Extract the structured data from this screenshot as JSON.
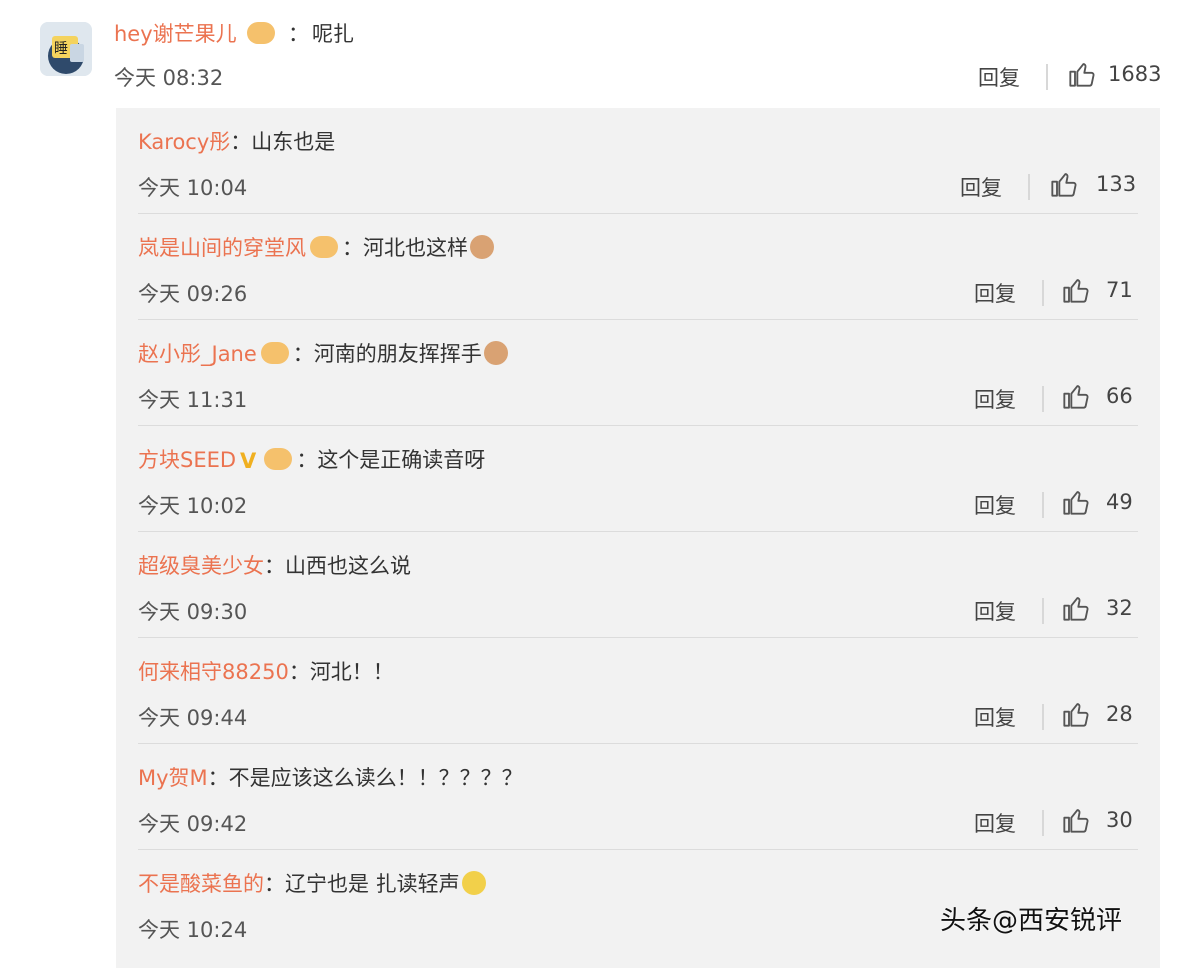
{
  "top_comment": {
    "username": "hey谢芒果儿",
    "text": "呢扎",
    "time": "今天 08:32",
    "reply_label": "回复",
    "like_count": "1683"
  },
  "replies": [
    {
      "username": "Karocy彤",
      "text": "山东也是",
      "time": "今天 10:04",
      "reply_label": "回复",
      "like_count": "133"
    },
    {
      "username": "岚是山间的穿堂风",
      "text": "河北也这样",
      "time": "今天 09:26",
      "reply_label": "回复",
      "like_count": "71"
    },
    {
      "username": "赵小彤_Jane",
      "text": "河南的朋友挥挥手",
      "time": "今天 11:31",
      "reply_label": "回复",
      "like_count": "66"
    },
    {
      "username": "方块SEED",
      "text": "这个是正确读音呀",
      "time": "今天 10:02",
      "reply_label": "回复",
      "like_count": "49"
    },
    {
      "username": "超级臭美少女",
      "text": "山西也这么说",
      "time": "今天 09:30",
      "reply_label": "回复",
      "like_count": "32"
    },
    {
      "username": "何来相守88250",
      "text": "河北！！",
      "time": "今天 09:44",
      "reply_label": "回复",
      "like_count": "28"
    },
    {
      "username": "My贺M",
      "text": "不是应该这么读么！！？？？？",
      "time": "今天 09:42",
      "reply_label": "回复",
      "like_count": "30"
    },
    {
      "username": "不是酸菜鱼的",
      "text": "辽宁也是 扎读轻声",
      "time": "今天 10:24"
    }
  ],
  "colon": "：",
  "watermark": "头条@西安锐评",
  "colors": {
    "username": "#eb7350",
    "reply_bg": "#f2f2f2"
  },
  "icons": {
    "like": "thumbs-up-icon",
    "avatar": "avatar-sleep-icon"
  }
}
